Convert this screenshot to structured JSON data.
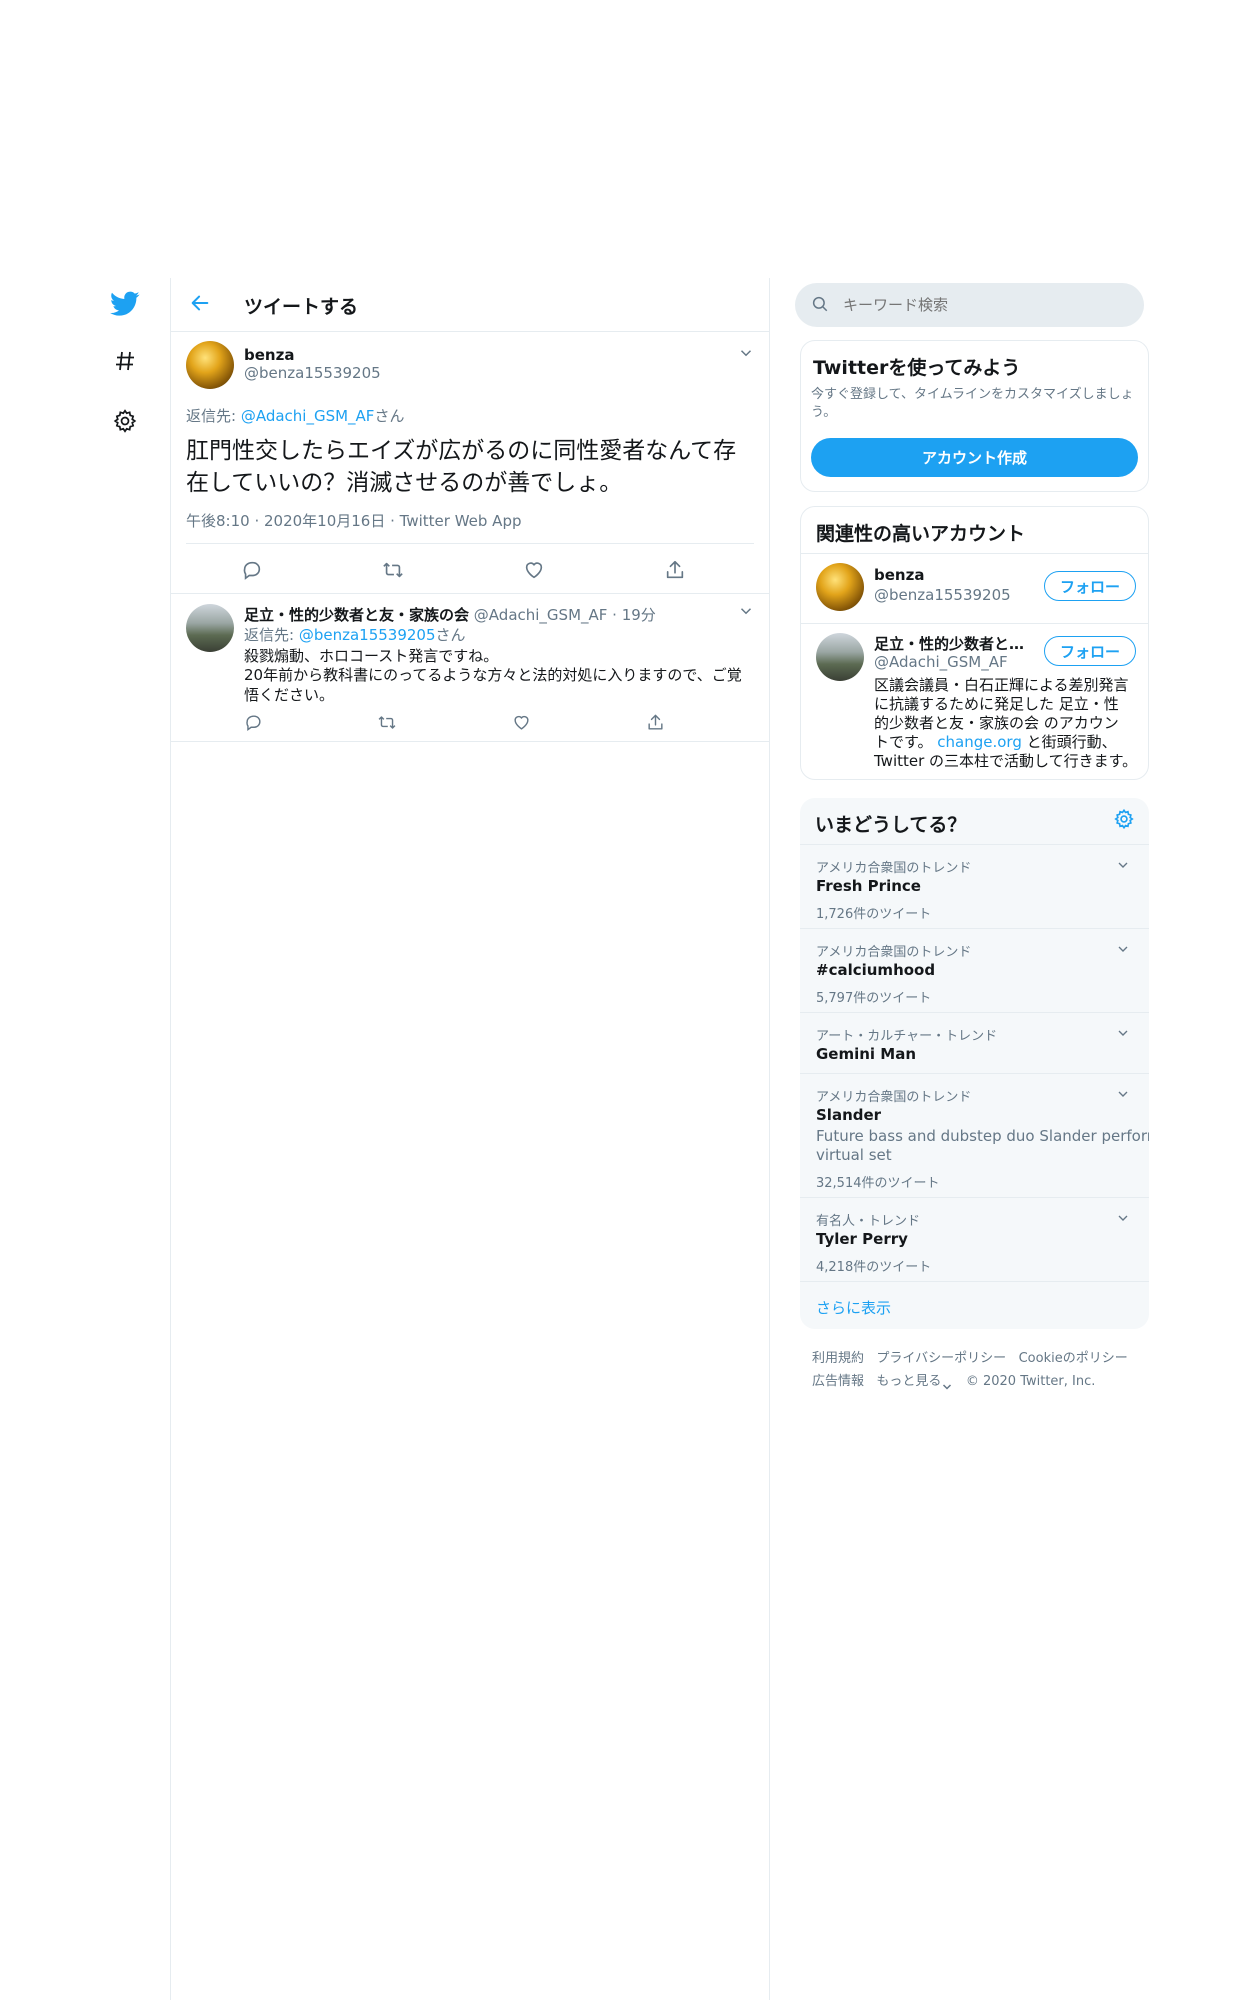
{
  "nav": {
    "icons": [
      "twitter-logo-icon",
      "hashtag-icon",
      "gear-icon"
    ]
  },
  "header": {
    "title": "ツイートする"
  },
  "main_tweet": {
    "display_name": "benza",
    "handle": "@benza15539205",
    "reply_prefix": "返信先: ",
    "reply_to": "@Adachi_GSM_AF",
    "reply_suffix": "さん",
    "text": "肛門性交したらエイズが広がるのに同性愛者なんて存在していいの？消滅させるのが善でしょ。",
    "time": "午後8:10",
    "date": "2020年10月16日",
    "source": "Twitter Web App"
  },
  "reply_tweet": {
    "display_name": "足立・性的少数者と友・家族の会",
    "handle": "@Adachi_GSM_AF",
    "time_ago": "19分",
    "reply_prefix": "返信先: ",
    "reply_to": "@benza15539205",
    "reply_suffix": "さん",
    "line1": "殺戮煽動、ホロコースト発言ですね。",
    "line2": "20年前から教科書にのってるような方々と法的対処に入りますので、ご覚悟ください。"
  },
  "search": {
    "placeholder": "キーワード検索"
  },
  "signup_card": {
    "title": "Twitterを使ってみよう",
    "desc": "今すぐ登録して、タイムラインをカスタマイズしましょう。",
    "button": "アカウント作成"
  },
  "related": {
    "title": "関連性の高いアカウント",
    "follow_label": "フォロー",
    "accounts": [
      {
        "name": "benza",
        "handle": "@benza15539205"
      },
      {
        "name": "足立・性的少数者と…",
        "handle": "@Adachi_GSM_AF",
        "bio_1": "区議会議員・白石正輝による差別発言",
        "bio_2": "に抗議するために発足した 足立・性",
        "bio_3": "的少数者と友・家族の会 のアカウン",
        "bio_4a": "トです。 ",
        "bio_4_link": "change.org",
        "bio_4b": " と街頭行動、",
        "bio_5": "Twitter の三本柱で活動して行きます。"
      }
    ]
  },
  "trends": {
    "title": "いまどうしてる？",
    "items": [
      {
        "category": "アメリカ合衆国のトレンド",
        "name": "Fresh Prince",
        "count": "1,726件のツイート"
      },
      {
        "category": "アメリカ合衆国のトレンド",
        "name": "#calciumhood",
        "count": "5,797件のツイート"
      },
      {
        "category": "アート・カルチャー・トレンド",
        "name": "Gemini Man"
      },
      {
        "category": "アメリカ合衆国のトレンド",
        "name": "Slander",
        "desc_1": "Future bass and dubstep duo Slander perform a",
        "desc_2": "virtual set",
        "count": "32,514件のツイート"
      },
      {
        "category": "有名人・トレンド",
        "name": "Tyler Perry",
        "count": "4,218件のツイート"
      }
    ],
    "show_more": "さらに表示"
  },
  "footer": {
    "links": [
      "利用規約",
      "プライバシーポリシー",
      "Cookieのポリシー",
      "広告情報",
      "もっと見る"
    ],
    "copyright": "© 2020 Twitter, Inc."
  }
}
